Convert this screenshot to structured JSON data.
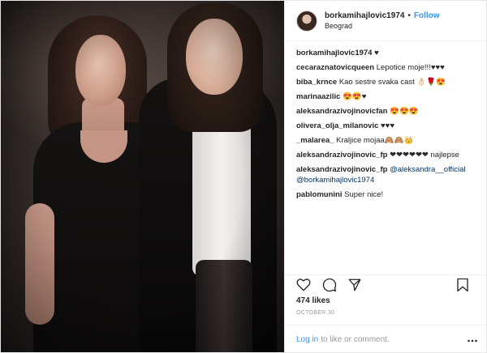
{
  "header": {
    "username": "borkamihajlovic1974",
    "separator": "•",
    "follow_label": "Follow",
    "location": "Beograd"
  },
  "comments": [
    {
      "user": "borkamihajlovic1974",
      "text": "♥"
    },
    {
      "user": "cecaraznatovicqueen",
      "text": "Lepotice moje!!!♥♥♥"
    },
    {
      "user": "biba_krnce",
      "text": "Kao sestre svaka cast 👌🏻🌹😍"
    },
    {
      "user": "marinaazilic",
      "text": "😍😍♥"
    },
    {
      "user": "aleksandrazivojinovicfan",
      "text": "😍😍😍"
    },
    {
      "user": "olivera_olja_milanovic",
      "text": "♥♥♥"
    },
    {
      "user": "_malarea_",
      "text": "Kraljice mojaa🙈🙈👑"
    },
    {
      "user": "aleksandrazivojinovic_fp",
      "text": "❤❤❤❤❤❤ najlepse"
    },
    {
      "user": "aleksandrazivojinovic_fp",
      "mention1": "@aleksandra__official",
      "mention2": "@borkamihajlovic1974",
      "text": ""
    },
    {
      "user": "pablomunini",
      "text": "Super nice!"
    }
  ],
  "actions": {
    "like_icon": "heart-outline-icon",
    "comment_icon": "speech-bubble-icon",
    "share_icon": "paper-plane-icon",
    "save_icon": "bookmark-icon"
  },
  "likes": "474 likes",
  "date": "OCTOBER 30",
  "login": {
    "login_link": "Log in",
    "rest": "to like or comment.",
    "more_icon": "more-dots-icon"
  },
  "colors": {
    "link_blue": "#3897f0",
    "mention_blue": "#003569",
    "text": "#262626",
    "muted": "#999999"
  }
}
